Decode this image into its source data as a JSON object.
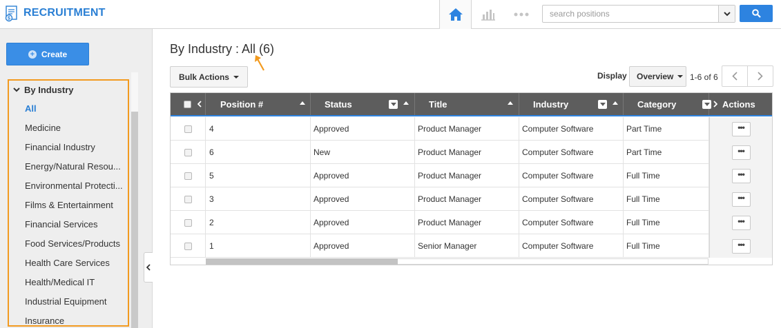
{
  "app": {
    "title": "RECRUITMENT"
  },
  "search": {
    "placeholder": "search positions",
    "value": ""
  },
  "sidebar": {
    "create_label": "Create",
    "group_label": "By Industry",
    "items": [
      {
        "label": "All",
        "active": true
      },
      {
        "label": "Medicine"
      },
      {
        "label": "Financial Industry"
      },
      {
        "label": "Energy/Natural Resou..."
      },
      {
        "label": "Environmental Protecti..."
      },
      {
        "label": "Films & Entertainment"
      },
      {
        "label": "Financial Services"
      },
      {
        "label": "Food Services/Products"
      },
      {
        "label": "Health Care Services"
      },
      {
        "label": "Health/Medical IT"
      },
      {
        "label": "Industrial Equipment"
      },
      {
        "label": "Insurance"
      }
    ]
  },
  "main": {
    "title": "By Industry : All (6)",
    "bulk_actions_label": "Bulk Actions",
    "display_label": "Display",
    "display_value": "Overview",
    "paging_text": "1-6 of 6"
  },
  "table": {
    "columns": [
      "Position #",
      "Status",
      "Title",
      "Industry",
      "Category",
      "Actions"
    ],
    "rows": [
      {
        "position": "4",
        "status": "Approved",
        "title": "Product Manager",
        "industry": "Computer Software",
        "category": "Part Time"
      },
      {
        "position": "6",
        "status": "New",
        "title": "Product Manager",
        "industry": "Computer Software",
        "category": "Part Time"
      },
      {
        "position": "5",
        "status": "Approved",
        "title": "Product Manager",
        "industry": "Computer Software",
        "category": "Full Time"
      },
      {
        "position": "3",
        "status": "Approved",
        "title": "Product Manager",
        "industry": "Computer Software",
        "category": "Full Time"
      },
      {
        "position": "2",
        "status": "Approved",
        "title": "Product Manager",
        "industry": "Computer Software",
        "category": "Full Time"
      },
      {
        "position": "1",
        "status": "Approved",
        "title": "Senior Manager",
        "industry": "Computer Software",
        "category": "Full Time"
      }
    ],
    "action_label": "•••"
  },
  "icons": {
    "home": "home-icon",
    "reports": "bar-chart-icon",
    "more": "more-dots-icon",
    "search": "search-icon",
    "filter": "filter-icon"
  },
  "colors": {
    "brand": "#2a7fd4",
    "accent_button": "#2d83e0",
    "highlight_border": "#f29a1f",
    "grid_header": "#5d5d5d"
  }
}
